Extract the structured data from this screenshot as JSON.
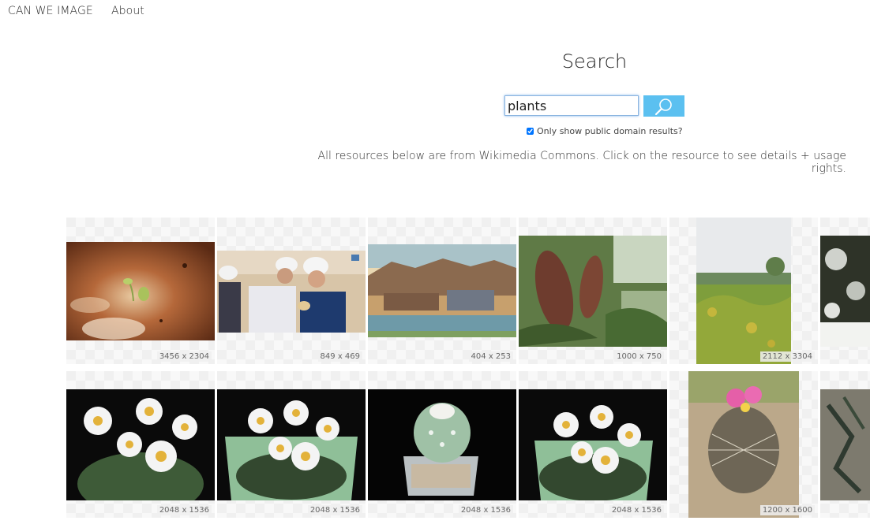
{
  "nav": {
    "brand": "CAN WE IMAGE",
    "about": "About"
  },
  "search": {
    "title": "Search",
    "query": "plants",
    "public_domain_label": "Only show public domain results?",
    "public_domain_checked": true,
    "notice": "All resources below are from Wikimedia Commons. Click on the resource to see details + usage rights."
  },
  "results": [
    {
      "dimensions": "3456 x 2304",
      "subject": "seedling-sprout"
    },
    {
      "dimensions": "849 x 469",
      "subject": "men-in-hard-hats"
    },
    {
      "dimensions": "404 x 253",
      "subject": "cement-plant-postcard"
    },
    {
      "dimensions": "1000 x 750",
      "subject": "banksia-flower-cones"
    },
    {
      "dimensions": "2112 x 3304",
      "subject": "field-vegetation"
    },
    {
      "dimensions": "",
      "subject": "snowy-shrub"
    },
    {
      "dimensions": "2048 x 1536",
      "subject": "flowering-cactus"
    },
    {
      "dimensions": "2048 x 1536",
      "subject": "flowering-cactus-pot"
    },
    {
      "dimensions": "2048 x 1536",
      "subject": "small-cactus-pot"
    },
    {
      "dimensions": "2048 x 1536",
      "subject": "flowering-cactus-closeup"
    },
    {
      "dimensions": "1200 x 1600",
      "subject": "pink-flowered-cactus"
    },
    {
      "dimensions": "",
      "subject": "thistle-plant"
    }
  ]
}
